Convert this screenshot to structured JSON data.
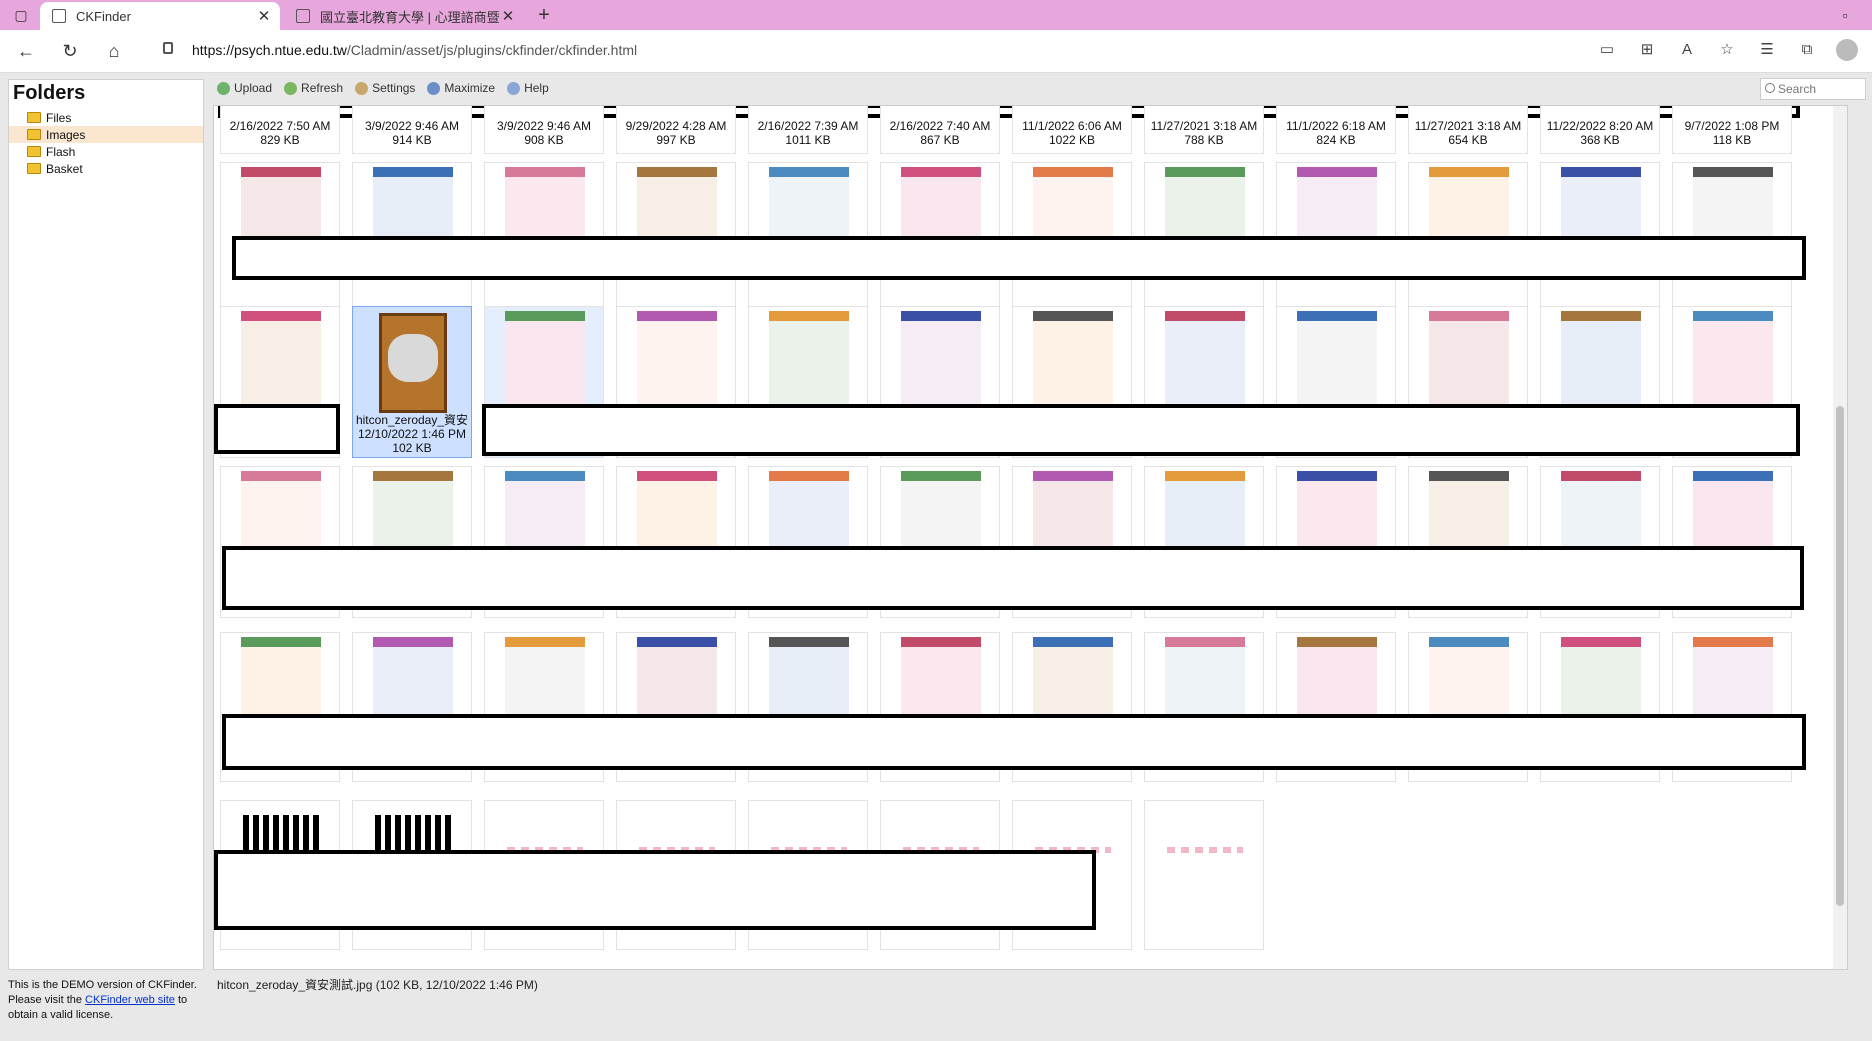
{
  "browser": {
    "tabs": [
      {
        "label": "CKFinder",
        "active": true
      },
      {
        "label": "國立臺北教育大學 | 心理諮商暨",
        "active": false
      }
    ],
    "url_host": "https://psych.ntue.edu.tw",
    "url_path": "/Cladmin/asset/js/plugins/ckfinder/ckfinder.html",
    "new_tab": "+",
    "close_tab": "✕"
  },
  "sidebar": {
    "title": "Folders",
    "folders": [
      {
        "label": "Files"
      },
      {
        "label": "Images"
      },
      {
        "label": "Flash"
      },
      {
        "label": "Basket"
      }
    ],
    "demo_text_1": "This is the DEMO version of CKFinder. Please visit the ",
    "demo_link": "CKFinder web site",
    "demo_text_2": " to obtain a valid license."
  },
  "toolbar": {
    "upload": "Upload",
    "refresh": "Refresh",
    "settings": "Settings",
    "maximize": "Maximize",
    "help": "Help",
    "search_placeholder": "Search"
  },
  "row1_meta": [
    {
      "date": "2/16/2022 7:50 AM",
      "size": "829 KB"
    },
    {
      "date": "3/9/2022 9:46 AM",
      "size": "914 KB"
    },
    {
      "date": "3/9/2022 9:46 AM",
      "size": "908 KB"
    },
    {
      "date": "9/29/2022 4:28 AM",
      "size": "997 KB"
    },
    {
      "date": "2/16/2022 7:39 AM",
      "size": "1011 KB"
    },
    {
      "date": "2/16/2022 7:40 AM",
      "size": "867 KB"
    },
    {
      "date": "11/1/2022 6:06 AM",
      "size": "1022 KB"
    },
    {
      "date": "11/27/2021 3:18 AM",
      "size": "788 KB"
    },
    {
      "date": "11/1/2022 6:18 AM",
      "size": "824 KB"
    },
    {
      "date": "11/27/2021 3:18 AM",
      "size": "654 KB"
    },
    {
      "date": "11/22/2022 8:20 AM",
      "size": "368 KB"
    },
    {
      "date": "9/7/2022 1:08 PM",
      "size": "118 KB"
    }
  ],
  "selected_item": {
    "name": "hitcon_zeroday_資安",
    "date": "12/10/2022 1:46 PM",
    "size": "102 KB"
  },
  "status": "hitcon_zeroday_資安測試.jpg (102 KB, 12/10/2022 1:46 PM)"
}
